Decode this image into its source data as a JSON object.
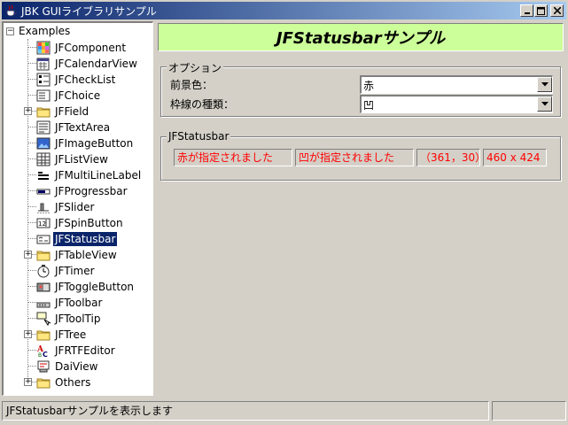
{
  "window": {
    "title": "JBK GUIライブラリサンプル",
    "buttons": [
      "minimize",
      "maximize",
      "close"
    ]
  },
  "tree": {
    "root": "Examples",
    "selected_index": 12,
    "items": [
      {
        "label": "JFComponent",
        "icon": "grid-color-icon",
        "expandable": false
      },
      {
        "label": "JFCalendarView",
        "icon": "calendar-icon",
        "expandable": false
      },
      {
        "label": "JFCheckList",
        "icon": "checklist-icon",
        "expandable": false
      },
      {
        "label": "JFChoice",
        "icon": "choice-icon",
        "expandable": false
      },
      {
        "label": "JFField",
        "icon": "folder-icon",
        "expandable": true
      },
      {
        "label": "JFTextArea",
        "icon": "text-area-icon",
        "expandable": false
      },
      {
        "label": "JFImageButton",
        "icon": "image-button-icon",
        "expandable": false
      },
      {
        "label": "JFListView",
        "icon": "list-view-icon",
        "expandable": false
      },
      {
        "label": "JFMultiLineLabel",
        "icon": "multiline-label-icon",
        "expandable": false
      },
      {
        "label": "JFProgressbar",
        "icon": "progressbar-icon",
        "expandable": false
      },
      {
        "label": "JFSlider",
        "icon": "slider-icon",
        "expandable": false
      },
      {
        "label": "JFSpinButton",
        "icon": "spin-button-icon",
        "expandable": false
      },
      {
        "label": "JFStatusbar",
        "icon": "statusbar-icon",
        "expandable": false
      },
      {
        "label": "JFTableView",
        "icon": "folder-icon",
        "expandable": true
      },
      {
        "label": "JFTimer",
        "icon": "timer-icon",
        "expandable": false
      },
      {
        "label": "JFToggleButton",
        "icon": "toggle-button-icon",
        "expandable": false
      },
      {
        "label": "JFToolbar",
        "icon": "toolbar-icon",
        "expandable": false
      },
      {
        "label": "JFToolTip",
        "icon": "tooltip-icon",
        "expandable": false
      },
      {
        "label": "JFTree",
        "icon": "folder-icon",
        "expandable": true
      },
      {
        "label": "JFRTFEditor",
        "icon": "rtf-editor-icon",
        "expandable": false
      },
      {
        "label": "DaiView",
        "icon": "dai-view-icon",
        "expandable": false
      },
      {
        "label": "Others",
        "icon": "folder-icon",
        "expandable": true
      }
    ]
  },
  "banner": {
    "title": "JFStatusbarサンプル",
    "color": "#ccff99"
  },
  "options": {
    "group_title": "オプション",
    "fg_color": {
      "label": "前景色：",
      "value": "赤"
    },
    "border_type": {
      "label": "枠線の種類：",
      "value": "凹"
    }
  },
  "statusbar_demo": {
    "group_title": "JFStatusbar",
    "panes": [
      "赤が指定されました",
      "凹が指定されました",
      "（361，30）",
      "460 x 424"
    ],
    "text_color": "#ff0000"
  },
  "status": {
    "message": "JFStatusbarサンプルを表示します",
    "secondary": ""
  }
}
